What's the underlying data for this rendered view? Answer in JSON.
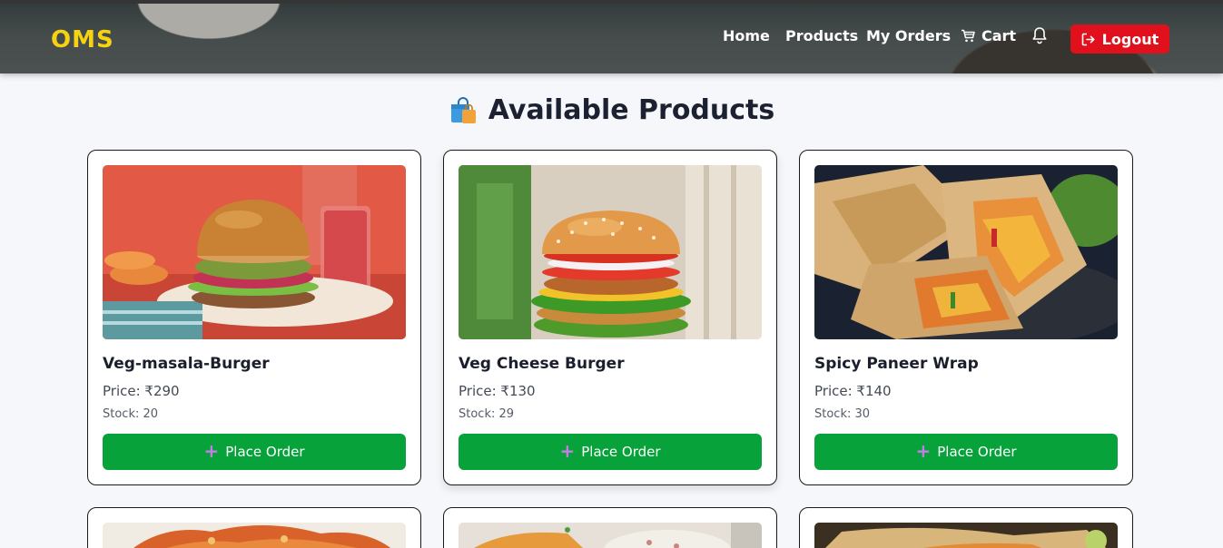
{
  "navbar": {
    "brand": "OMS",
    "links": {
      "home": "Home",
      "products": "Products",
      "orders": "My Orders",
      "cart": "Cart"
    },
    "logout_label": "Logout",
    "colors": {
      "brand": "#f6d211",
      "logout_bg": "#e0101c"
    }
  },
  "page": {
    "title": "Available Products",
    "title_icon": "shopping-bag-icon"
  },
  "products": [
    {
      "name": "Veg-masala-Burger",
      "price": "Price: ₹290",
      "stock": "Stock: 20",
      "button": "Place Order"
    },
    {
      "name": "Veg Cheese Burger",
      "price": "Price: ₹130",
      "stock": "Stock: 29",
      "button": "Place Order"
    },
    {
      "name": "Spicy Paneer Wrap",
      "price": "Price: ₹140",
      "stock": "Stock: 30",
      "button": "Place Order"
    }
  ],
  "colors": {
    "order_button": "#07a33a",
    "plus_icon": "#c77be6"
  }
}
